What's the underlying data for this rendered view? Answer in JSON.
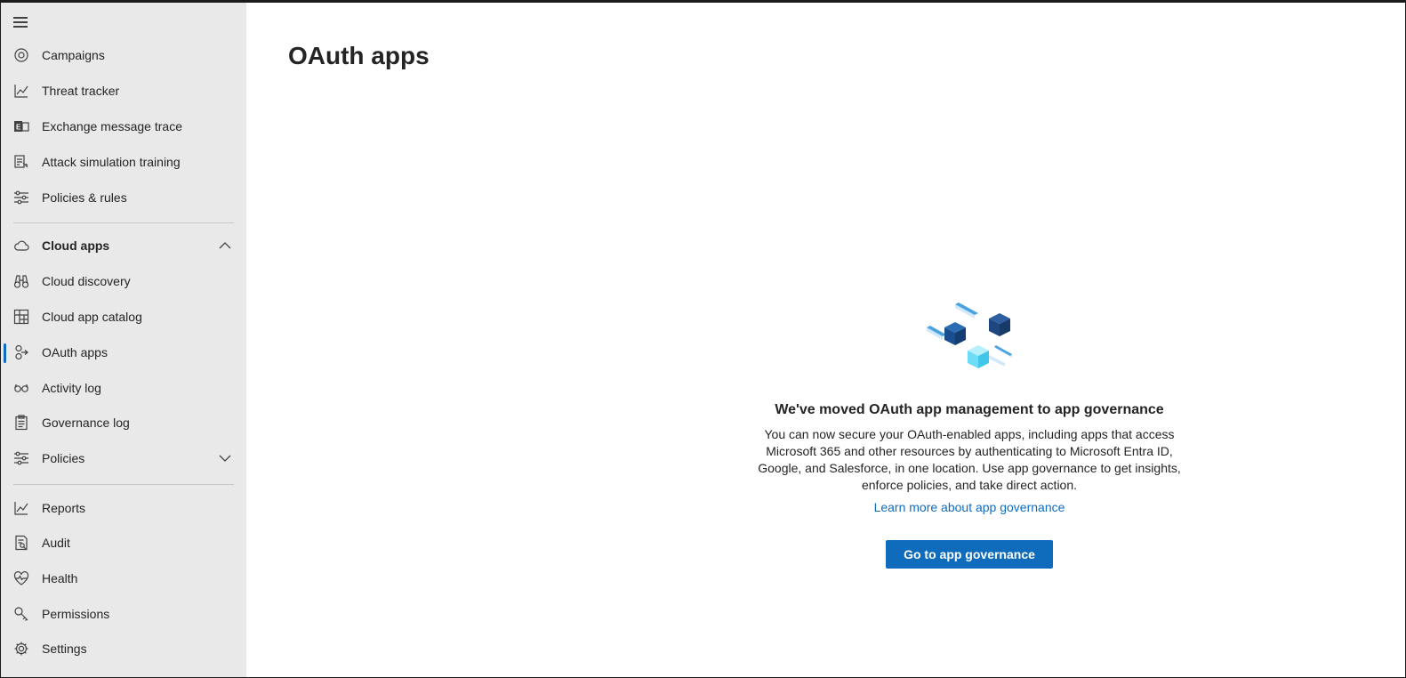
{
  "sidebar": {
    "menu_icon": "hamburger-icon",
    "items": [
      {
        "label": "Campaigns",
        "icon": "target-icon"
      },
      {
        "label": "Threat tracker",
        "icon": "line-chart-icon"
      },
      {
        "label": "Exchange message trace",
        "icon": "exchange-icon"
      },
      {
        "label": "Attack simulation training",
        "icon": "simulation-icon"
      },
      {
        "label": "Policies & rules",
        "icon": "sliders-icon"
      }
    ],
    "group": {
      "label": "Cloud apps",
      "icon": "cloud-icon",
      "expanded": true
    },
    "group_items": [
      {
        "label": "Cloud discovery",
        "icon": "binoculars-icon"
      },
      {
        "label": "Cloud app catalog",
        "icon": "grid-icon"
      },
      {
        "label": "OAuth apps",
        "icon": "oauth-icon",
        "selected": true
      },
      {
        "label": "Activity log",
        "icon": "glasses-icon"
      },
      {
        "label": "Governance log",
        "icon": "clipboard-icon"
      },
      {
        "label": "Policies",
        "icon": "sliders-icon",
        "expandable": true
      }
    ],
    "bottom_items": [
      {
        "label": "Reports",
        "icon": "line-chart-icon"
      },
      {
        "label": "Audit",
        "icon": "audit-icon"
      },
      {
        "label": "Health",
        "icon": "heart-pulse-icon"
      },
      {
        "label": "Permissions",
        "icon": "key-icon"
      },
      {
        "label": "Settings",
        "icon": "gear-icon"
      }
    ]
  },
  "main": {
    "title": "OAuth apps",
    "empty_state": {
      "illustration": "cubes-illustration",
      "heading": "We've moved OAuth app management to app governance",
      "body": "You can now secure your OAuth-enabled apps, including apps that access Microsoft 365 and other resources by authenticating to Microsoft Entra ID, Google, and Salesforce, in one location. Use app governance to get insights, enforce policies, and take direct action.",
      "link": "Learn more about app governance",
      "button": "Go to app governance"
    }
  },
  "colors": {
    "accent": "#0f6cbd",
    "sidebar_bg": "#e9e9e9",
    "text": "#242424"
  }
}
